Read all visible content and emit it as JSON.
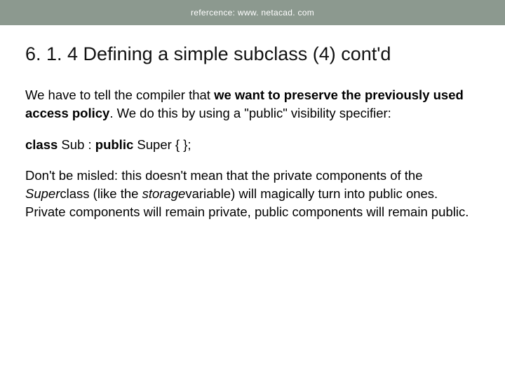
{
  "topbar": {
    "reference": "refercence: www. netacad. com"
  },
  "heading": "6. 1. 4 Defining a simple subclass (4) cont'd",
  "p1": {
    "t1": "We have to tell the compiler that ",
    "b1": "we want to preserve the previously used access policy",
    "t2": ". We do this by using a \"public\" visibility specifier:"
  },
  "code": {
    "c1": "class",
    "c2": " Sub : ",
    "c3": "public",
    "c4": " Super {   };"
  },
  "p2": {
    "t1": "Don't be misled: this doesn't mean that the private components of the ",
    "i1": "Super",
    "t2": "class (like the ",
    "i2": "storage",
    "t3": "variable) will magically turn into public ones. Private components will remain private, public components will remain public."
  }
}
